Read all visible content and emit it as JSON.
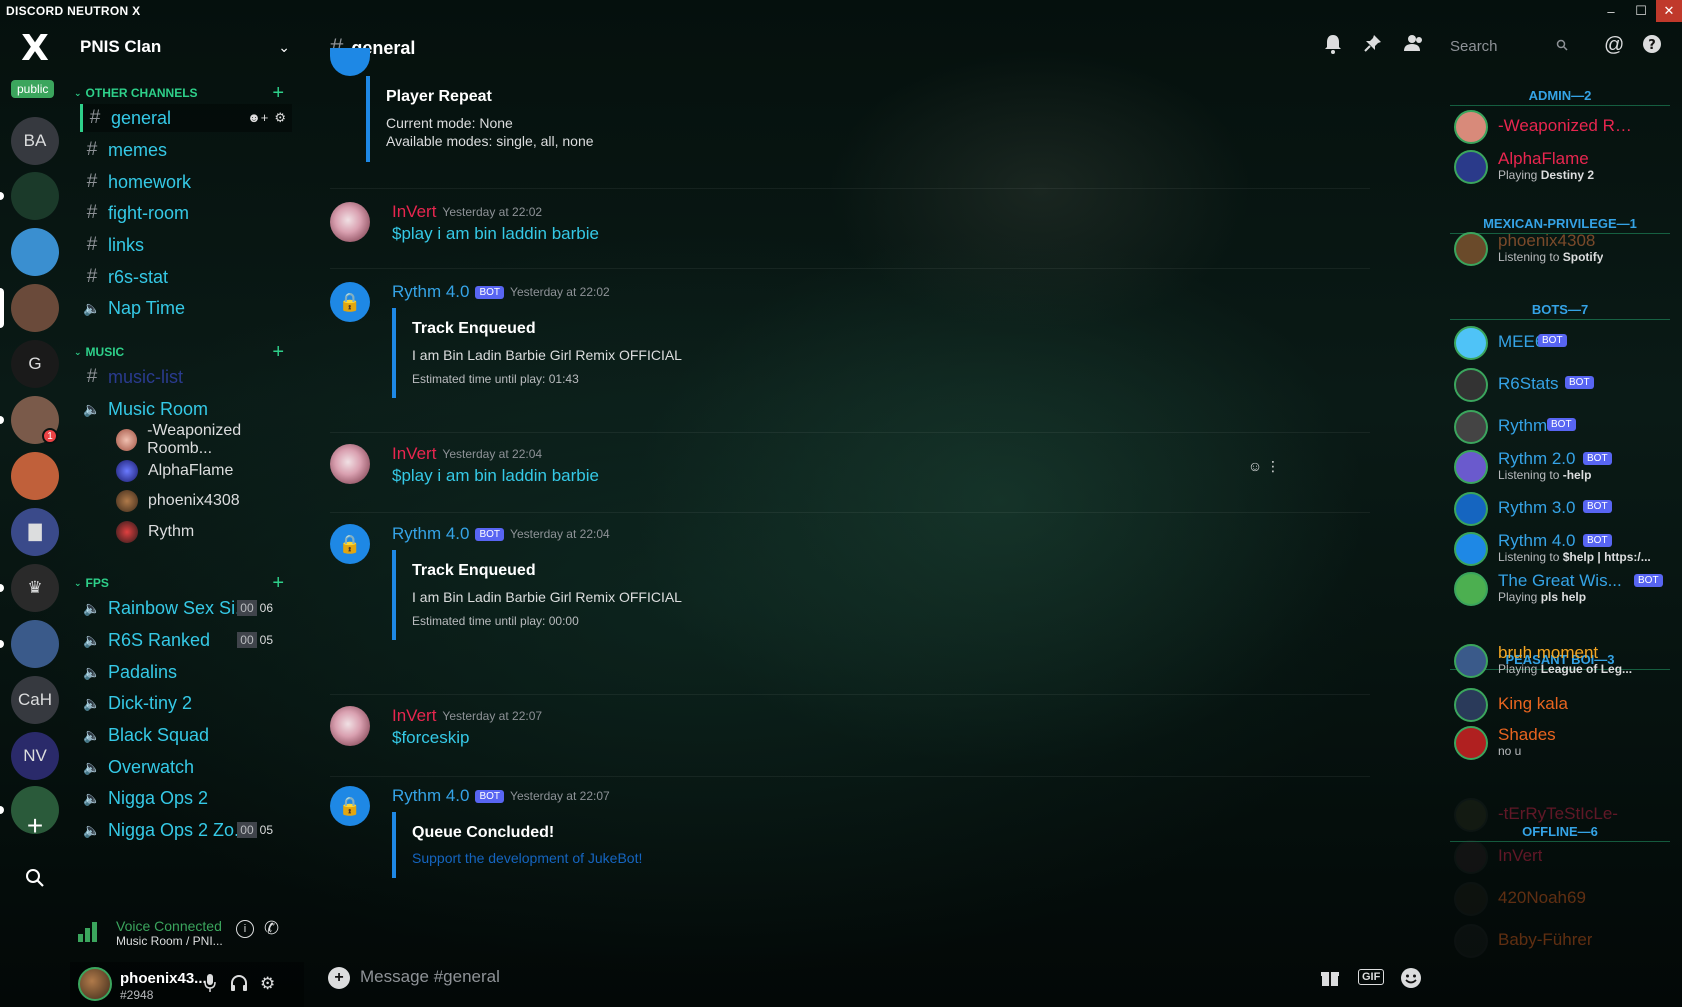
{
  "window": {
    "title": "DISCORD NEUTRON X",
    "controls": [
      "–",
      "☐",
      "✕"
    ]
  },
  "guilds": {
    "logo": "X",
    "badge": "public",
    "items": [
      {
        "initials": "BA",
        "bg": "#36393f"
      },
      {
        "initials": "",
        "bg": "#1b3a2a"
      },
      {
        "initials": "",
        "bg": "#3a8fd0"
      },
      {
        "initials": "",
        "bg": "#6a4a3a"
      },
      {
        "initials": "G",
        "bg": "#1a1a1a"
      },
      {
        "initials": "",
        "bg": "#7a5a4a",
        "mention": "1"
      },
      {
        "initials": "",
        "bg": "#c0603a"
      },
      {
        "initials": "▇",
        "bg": "#3a4a8a"
      },
      {
        "initials": "♛",
        "bg": "#2a2a2a"
      },
      {
        "initials": "",
        "bg": "#3a5a8a"
      },
      {
        "initials": "CaH",
        "bg": "#36393f"
      },
      {
        "initials": "NV",
        "bg": "#2a2a6a"
      },
      {
        "initials": "",
        "bg": "#2a5a3a"
      }
    ]
  },
  "server": {
    "name": "PNIS Clan"
  },
  "categories": {
    "other": "OTHER CHANNELS",
    "music": "MUSIC",
    "fps": "FPS"
  },
  "channels": {
    "other": [
      "general",
      "memes",
      "homework",
      "fight-room",
      "links",
      "r6s-stat",
      "Nap Time"
    ],
    "music": [
      "music-list",
      "Music Room"
    ],
    "music_room_users": [
      "-Weaponized Roomb...",
      "AlphaFlame",
      "phoenix4308",
      "Rythm"
    ],
    "fps": [
      "Rainbow Sex Si...",
      "R6S Ranked",
      "Padalins",
      "Dick-tiny 2",
      "Black Squad",
      "Overwatch",
      "Nigga Ops 2",
      "Nigga Ops 2 Zo..."
    ],
    "fps_counts": [
      [
        "00",
        "06"
      ],
      [
        "00",
        "05"
      ],
      [
        "00",
        "05"
      ]
    ]
  },
  "voice": {
    "status": "Voice Connected",
    "location": "Music Room / PNI..."
  },
  "user": {
    "name": "phoenix43...",
    "tag": "#2948"
  },
  "header": {
    "channel": "general",
    "search_placeholder": "Search"
  },
  "messages": {
    "m0": {
      "title": "Player Repeat",
      "line1": "Current mode: None",
      "line2": "Available modes: single, all, none"
    },
    "m1": {
      "author": "InVert",
      "time": "Yesterday at 22:02",
      "text": "$play i am bin laddin barbie"
    },
    "m2": {
      "author": "Rythm 4.0",
      "bot": "BOT",
      "time": "Yesterday at 22:02",
      "title": "Track Enqueued",
      "desc": "I am Bin Ladin Barbie Girl Remix OFFICIAL",
      "foot": "Estimated time until play: 01:43"
    },
    "m3": {
      "author": "InVert",
      "time": "Yesterday at 22:04",
      "text": "$play i am bin laddin barbie"
    },
    "m4": {
      "author": "Rythm 4.0",
      "bot": "BOT",
      "time": "Yesterday at 22:04",
      "title": "Track Enqueued",
      "desc": "I am Bin Ladin Barbie Girl Remix OFFICIAL",
      "foot": "Estimated time until play: 00:00"
    },
    "m5": {
      "author": "InVert",
      "time": "Yesterday at 22:07",
      "text": "$forceskip"
    },
    "m6": {
      "author": "Rythm 4.0",
      "bot": "BOT",
      "time": "Yesterday at 22:07",
      "title": "Queue Concluded!",
      "link": "Support the development of JukeBot!"
    }
  },
  "composer": {
    "placeholder": "Message #general",
    "gif": "GIF"
  },
  "members": {
    "admin": "ADMIN—2",
    "mexican": "MEXICAN-PRIVILEGE—1",
    "bots": "BOTS—7",
    "peasant": "PEASANT BOI—3",
    "offline": "OFFLINE—6",
    "list": [
      {
        "name": "-Weaponized Roo...",
        "color": "#e8264f"
      },
      {
        "name": "AlphaFlame",
        "color": "#e8264f",
        "activity": "Playing",
        "detail": "Destiny 2"
      },
      {
        "name": "phoenix4308",
        "color": "#7a4a2a",
        "activity": "Listening to",
        "detail": "Spotify"
      },
      {
        "name": "MEE6",
        "color": "#35a3e6",
        "bot": "BOT"
      },
      {
        "name": "R6Stats",
        "color": "#35a3e6",
        "bot": "BOT"
      },
      {
        "name": "Rythm",
        "color": "#35a3e6",
        "bot": "BOT"
      },
      {
        "name": "Rythm 2.0",
        "color": "#35a3e6",
        "bot": "BOT",
        "activity": "Listening to",
        "detail": "-help"
      },
      {
        "name": "Rythm 3.0",
        "color": "#35a3e6",
        "bot": "BOT"
      },
      {
        "name": "Rythm 4.0",
        "color": "#35a3e6",
        "bot": "BOT",
        "activity": "Listening to",
        "detail": "$help | https:/..."
      },
      {
        "name": "The Great Wis...",
        "color": "#35a3e6",
        "bot": "BOT",
        "activity": "Playing",
        "detail": "pls help"
      },
      {
        "name": "bruh moment",
        "color": "#f5a623",
        "activity": "Playing",
        "detail": "League of Leg..."
      },
      {
        "name": "King kala",
        "color": "#e8641f"
      },
      {
        "name": "Shades",
        "color": "#e8641f",
        "activity": "no u"
      },
      {
        "name": "-tErRyTeStIcLe-",
        "color": "#e8264f"
      },
      {
        "name": "InVert",
        "color": "#e8264f"
      },
      {
        "name": "420Noah69",
        "color": "#e8641f"
      },
      {
        "name": "Baby-Führer",
        "color": "#e8641f"
      }
    ]
  }
}
